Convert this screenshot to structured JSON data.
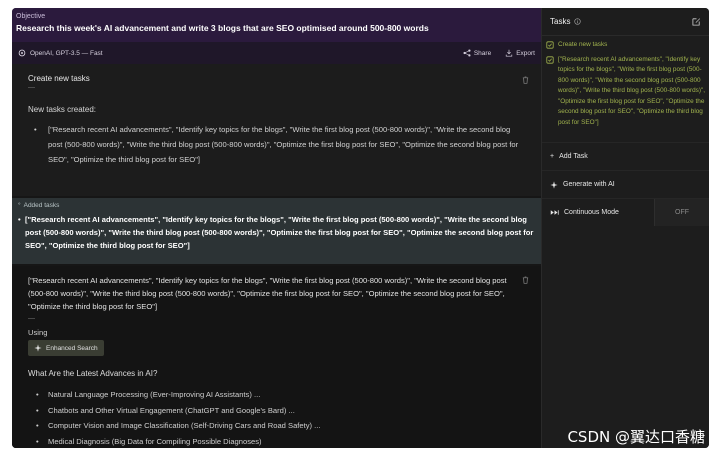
{
  "header": {
    "objective_label": "Objective",
    "objective_text": "Research this week's AI advancement and write 3 blogs that are SEO optimised around 500-800 words",
    "model": "OpenAI, GPT-3.5 — Fast",
    "share_label": "Share",
    "export_label": "Export"
  },
  "feed": {
    "create_card": {
      "title": "Create new tasks",
      "dash": "—",
      "subtitle": "New tasks created:",
      "tasks_text": "[\"Research recent AI advancements\", \"Identify key topics for the blogs\", \"Write the first blog post (500-800 words)\", \"Write the second blog post (500-800 words)\", \"Write the third blog post (500-800 words)\", \"Optimize the first blog post for SEO\", \"Optimize the second blog post for SEO\", \"Optimize the third blog post for SEO\"]"
    },
    "added": {
      "header": "Added tasks",
      "text": "[\"Research recent AI advancements\", \"Identify key topics for the blogs\", \"Write the first blog post (500-800 words)\", \"Write the second blog post (500-800 words)\", \"Write the third blog post (500-800 words)\", \"Optimize the first blog post for SEO\", \"Optimize the second blog post for SEO\", \"Optimize the third blog post for SEO\"]"
    },
    "result_card": {
      "text": "[\"Research recent AI advancements\", \"Identify key topics for the blogs\", \"Write the first blog post (500-800 words)\", \"Write the second blog post (500-800 words)\", \"Write the third blog post (500-800 words)\", \"Optimize the first blog post for SEO\", \"Optimize the second blog post for SEO\", \"Optimize the third blog post for SEO\"]",
      "dash": "—",
      "using_label": "Using",
      "tool_label": "Enhanced Search",
      "question": "What Are the Latest Advances in AI?",
      "advances": [
        "Natural Language Processing (Ever-Improving AI Assistants) ...",
        "Chatbots and Other Virtual Engagement (ChatGPT and Google's Bard) ...",
        "Computer Vision and Image Classification (Self-Driving Cars and Road Safety) ...",
        "Medical Diagnosis (Big Data for Compiling Possible Diagnoses)"
      ]
    }
  },
  "panel": {
    "title": "Tasks",
    "tasks": [
      "Create new tasks",
      "[\"Research recent AI advancements\", \"Identify key topics for the blogs\", \"Write the first blog post (500-800 words)\", \"Write the second blog post (500-800 words)\", \"Write the third blog post (500-800 words)\", \"Optimize the first blog post for SEO\", \"Optimize the second blog post for SEO\", \"Optimize the third blog post for SEO\"]"
    ],
    "add_task_label": "Add Task",
    "generate_label": "Generate with AI",
    "continuous_label": "Continuous Mode",
    "continuous_state": "OFF"
  },
  "watermark": "CSDN @翼达口香糖",
  "colors": {
    "header_bg": "#2b1a3d",
    "task_accent": "#a2b44e",
    "added_bg": "#2c3335"
  }
}
